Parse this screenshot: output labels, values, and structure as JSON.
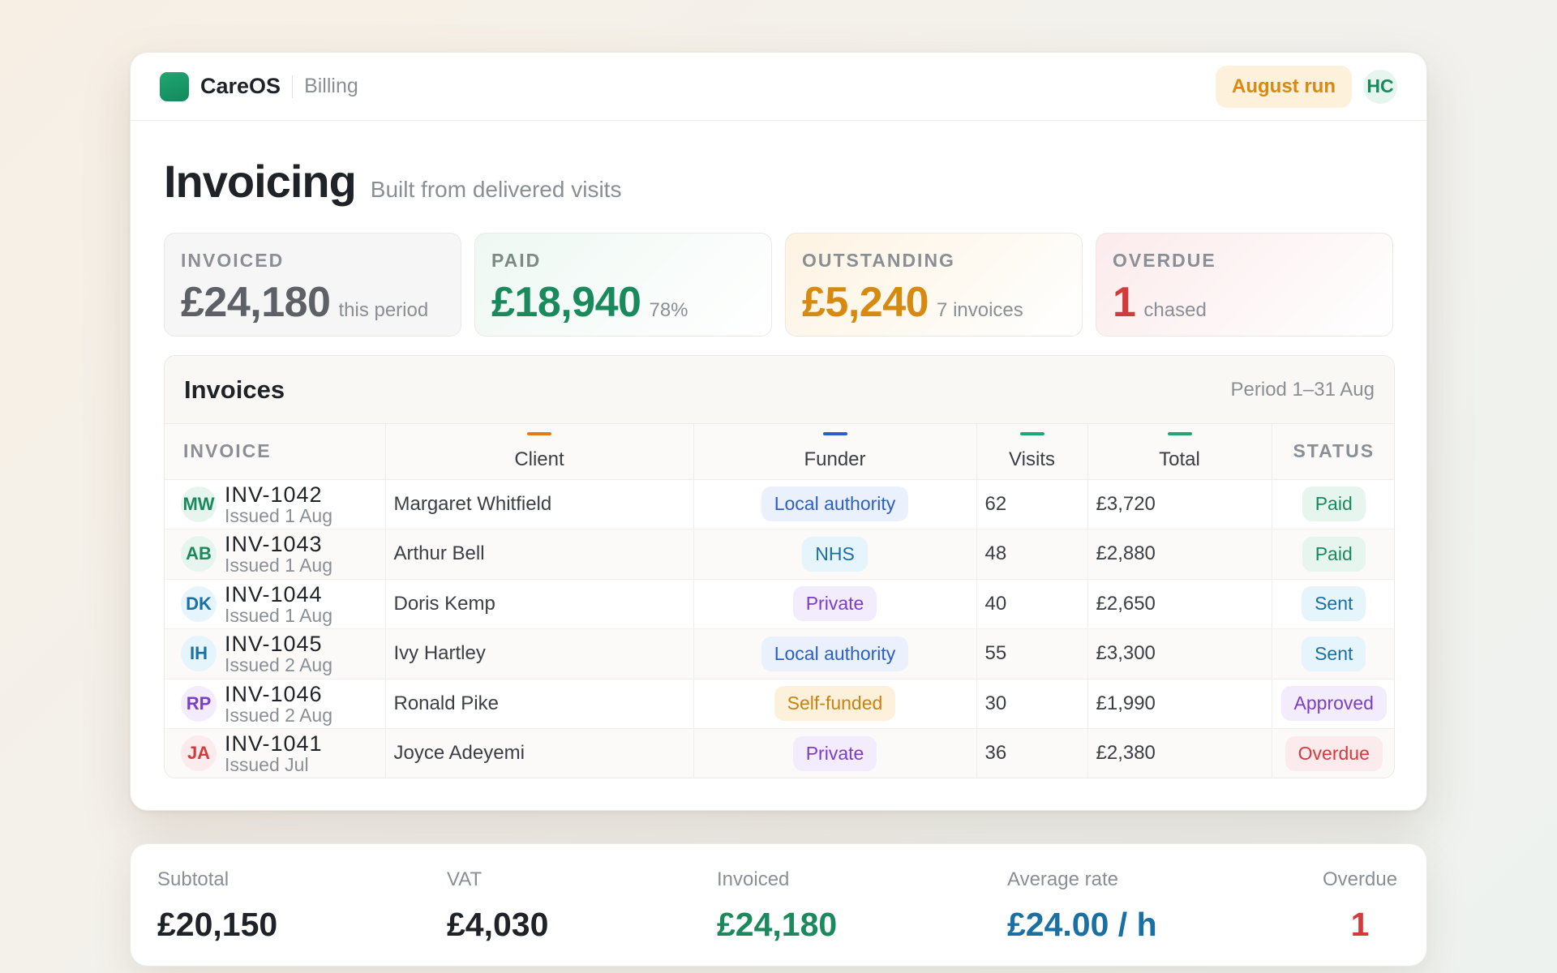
{
  "topbar": {
    "brand": "CareOS",
    "section": "Billing",
    "run_label": "August run",
    "user_initials": "HC"
  },
  "page": {
    "title": "Invoicing",
    "subtitle": "Built from delivered visits"
  },
  "stats": [
    {
      "label": "INVOICED",
      "value": "£24,180",
      "note": "this period"
    },
    {
      "label": "PAID",
      "value": "£18,940",
      "note": "78%"
    },
    {
      "label": "OUTSTANDING",
      "value": "£5,240",
      "note": "7 invoices"
    },
    {
      "label": "OVERDUE",
      "value": "1",
      "note": "chased"
    }
  ],
  "table": {
    "title": "Invoices",
    "period": "Period 1–31 Aug",
    "columns": [
      "INVOICE",
      "Client",
      "Funder",
      "Visits",
      "Total",
      "STATUS"
    ],
    "column_marker_colors": {
      "client": "#e07b1a",
      "funder": "#2b5fc4",
      "visits": "#1fa671",
      "total": "#1fa671"
    },
    "rows": [
      {
        "initials": "MW",
        "invoice": "INV-1042",
        "issued": "Issued 1 Aug",
        "client": "Margaret Whitfield",
        "funder": "Local authority",
        "visits": "62",
        "total": "£3,720",
        "status": "Paid"
      },
      {
        "initials": "AB",
        "invoice": "INV-1043",
        "issued": "Issued 1 Aug",
        "client": "Arthur Bell",
        "funder": "NHS",
        "visits": "48",
        "total": "£2,880",
        "status": "Paid"
      },
      {
        "initials": "DK",
        "invoice": "INV-1044",
        "issued": "Issued 1 Aug",
        "client": "Doris Kemp",
        "funder": "Private",
        "visits": "40",
        "total": "£2,650",
        "status": "Sent"
      },
      {
        "initials": "IH",
        "invoice": "INV-1045",
        "issued": "Issued 2 Aug",
        "client": "Ivy Hartley",
        "funder": "Local authority",
        "visits": "55",
        "total": "£3,300",
        "status": "Sent"
      },
      {
        "initials": "RP",
        "invoice": "INV-1046",
        "issued": "Issued 2 Aug",
        "client": "Ronald Pike",
        "funder": "Self-funded",
        "visits": "30",
        "total": "£1,990",
        "status": "Approved"
      },
      {
        "initials": "JA",
        "invoice": "INV-1041",
        "issued": "Issued Jul",
        "client": "Joyce Adeyemi",
        "funder": "Private",
        "visits": "36",
        "total": "£2,380",
        "status": "Overdue"
      }
    ]
  },
  "summary": {
    "subtotal_label": "Subtotal",
    "subtotal": "£20,150",
    "vat_label": "VAT",
    "vat": "£4,030",
    "invoiced_label": "Invoiced",
    "invoiced": "£24,180",
    "rate_label": "Average rate",
    "rate": "£24.00 / h",
    "overdue_label": "Overdue",
    "overdue": "1"
  },
  "colors": {
    "accent_green": "#1a8a5d",
    "warning_amber": "#d68a12",
    "danger_red": "#d43a3a",
    "info_blue": "#1a6fa3"
  }
}
